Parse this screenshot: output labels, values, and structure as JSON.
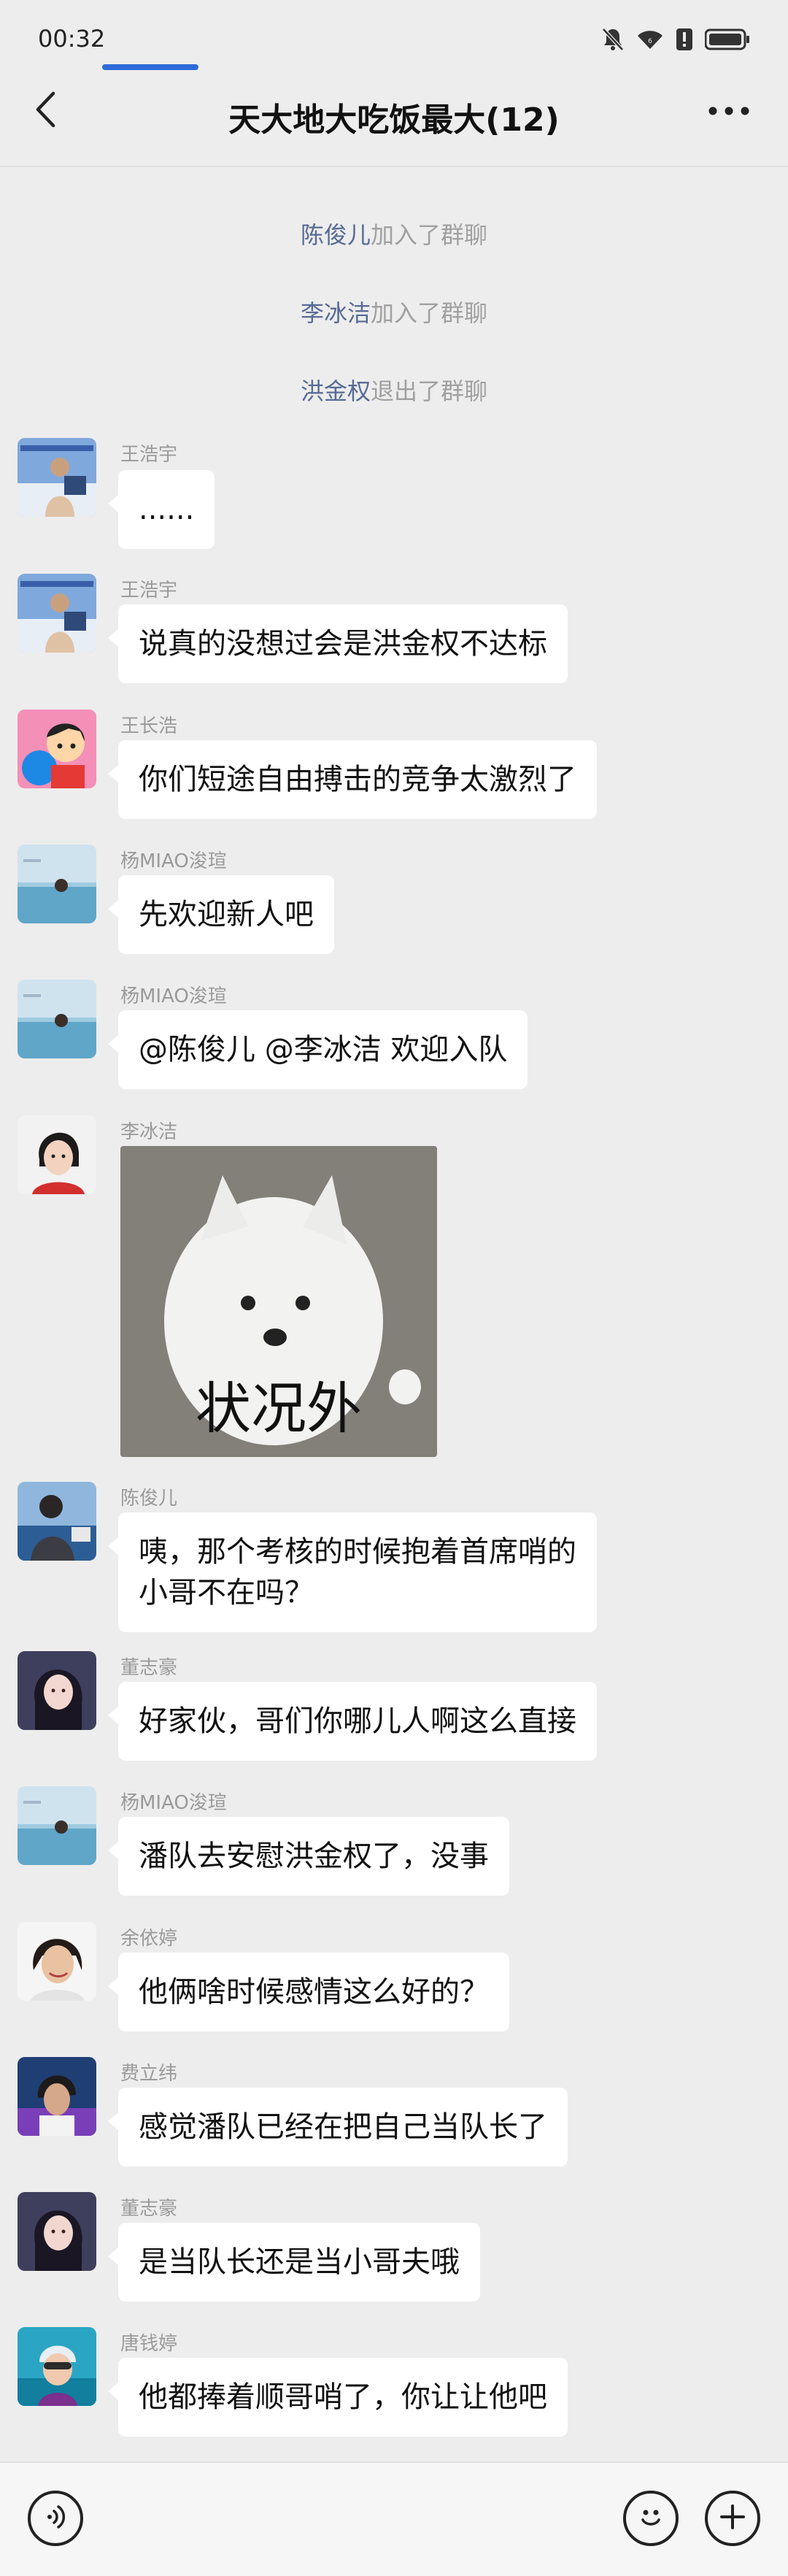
{
  "status": {
    "time": "00:32",
    "icons": [
      "mute-bell-icon",
      "wifi-icon",
      "alert-icon",
      "battery-icon"
    ]
  },
  "header": {
    "title": "天大地大吃饭最大(12)",
    "back_icon": "chevron-left-icon",
    "more_icon": "more-dots-icon"
  },
  "system_notices": [
    {
      "name": "陈俊儿",
      "action": "加入了群聊"
    },
    {
      "name": "李冰洁",
      "action": "加入了群聊"
    },
    {
      "name": "洪金权",
      "action": "退出了群聊"
    }
  ],
  "messages": [
    {
      "sender": "王浩宇",
      "text": "......"
    },
    {
      "sender": "王浩宇",
      "text": "说真的没想过会是洪金权不达标"
    },
    {
      "sender": "王长浩",
      "text": "你们短途自由搏击的竞争太激烈了"
    },
    {
      "sender": "杨MIAO浚瑄",
      "text": "先欢迎新人吧"
    },
    {
      "sender": "杨MIAO浚瑄",
      "text": "@陈俊儿 @李冰洁 欢迎入队"
    },
    {
      "sender": "李冰洁",
      "sticker_text": "状况外"
    },
    {
      "sender": "陈俊儿",
      "text": "咦，那个考核的时候抱着首席哨的\n小哥不在吗？"
    },
    {
      "sender": "董志豪",
      "text": "好家伙，哥们你哪儿人啊这么直接"
    },
    {
      "sender": "杨MIAO浚瑄",
      "text": "潘队去安慰洪金权了，没事"
    },
    {
      "sender": "余依婷",
      "text": "他俩啥时候感情这么好的？"
    },
    {
      "sender": "费立纬",
      "text": "感觉潘队已经在把自己当队长了"
    },
    {
      "sender": "董志豪",
      "text": "是当队长还是当小哥夫哦"
    },
    {
      "sender": "唐钱婷",
      "text": "他都捧着顺哥哨了，你让让他吧"
    }
  ],
  "bottom_bar": {
    "voice_icon": "voice-icon",
    "emoji_icon": "emoji-icon",
    "plus_icon": "plus-icon"
  },
  "colors": {
    "background": "#ededed",
    "bubble": "#ffffff",
    "system_name": "#576b95",
    "system_text": "#a0a0a0",
    "sender": "#9a9a9a"
  }
}
